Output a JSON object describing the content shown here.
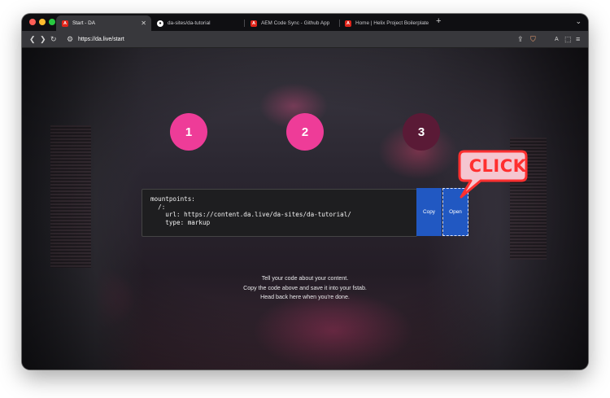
{
  "browser": {
    "tabs": [
      {
        "label": "Start - DA",
        "active": true,
        "icon": "adobe-icon"
      },
      {
        "label": "da-sites/da-tutorial",
        "active": false,
        "icon": "github-icon"
      },
      {
        "label": "AEM Code Sync - Github App",
        "active": false,
        "icon": "adobe-icon"
      },
      {
        "label": "Home | Helix Project Boilerplate",
        "active": false,
        "icon": "adobe-icon"
      }
    ],
    "new_tab_label": "+",
    "url": "https://da.live/start"
  },
  "steps": [
    {
      "label": "1",
      "active": true
    },
    {
      "label": "2",
      "active": true
    },
    {
      "label": "3",
      "active": false
    }
  ],
  "code": {
    "text": "mountpoints:\n  /:\n    url: https://content.da.live/da-sites/da-tutorial/\n    type: markup"
  },
  "buttons": {
    "copy": "Copy",
    "open": "Open"
  },
  "callout": {
    "text": "CLICK"
  },
  "instructions": [
    "Tell your code about your content.",
    "Copy the code above and save it into your fstab.",
    "Head back here when you're done."
  ],
  "colors": {
    "step_active": "#ee3c98",
    "step_inactive": "#5a1a36",
    "button": "#2158c2",
    "callout": "#ff2f2f"
  }
}
